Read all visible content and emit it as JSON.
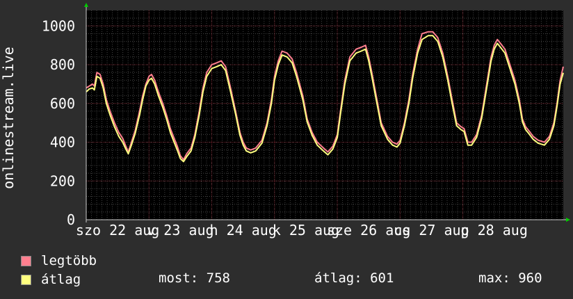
{
  "colors": {
    "background": "#2d2d2d",
    "plot_background": "#000000",
    "grid_major": "#6a1c26",
    "grid_minor": "#444444",
    "max_series": "#ff7f8f",
    "avg_series": "#ffff80",
    "axis_arrow": "#00cc00",
    "text": "#ffffff"
  },
  "chart_data": {
    "type": "line",
    "ylabel": "onlinestream.live",
    "ylim": [
      0,
      1080
    ],
    "yticks": [
      0,
      200,
      400,
      600,
      800,
      1000
    ],
    "xlim_days": [
      0,
      7.6
    ],
    "day_labels": [
      "szo 22 aug",
      "v 23 aug",
      "h 24 aug",
      "k 25 aug",
      "sze 26 aug",
      "cs 27 aug",
      "p 28 aug"
    ],
    "series": [
      {
        "name": "legtöbb",
        "key": "max",
        "x": [
          0,
          0.05,
          0.1,
          0.13,
          0.17,
          0.22,
          0.27,
          0.32,
          0.38,
          0.45,
          0.52,
          0.58,
          0.63,
          0.67,
          0.72,
          0.78,
          0.85,
          0.9,
          0.95,
          1.0,
          1.04,
          1.09,
          1.15,
          1.22,
          1.28,
          1.34,
          1.4,
          1.45,
          1.5,
          1.55,
          1.6,
          1.67,
          1.73,
          1.8,
          1.86,
          1.92,
          2.0,
          2.08,
          2.15,
          2.22,
          2.3,
          2.38,
          2.45,
          2.5,
          2.55,
          2.62,
          2.7,
          2.8,
          2.88,
          2.95,
          3.0,
          3.06,
          3.12,
          3.2,
          3.28,
          3.35,
          3.45,
          3.52,
          3.6,
          3.68,
          3.78,
          3.85,
          3.93,
          4.0,
          4.05,
          4.12,
          4.2,
          4.3,
          4.38,
          4.45,
          4.5,
          4.55,
          4.62,
          4.7,
          4.8,
          4.88,
          4.95,
          5.0,
          5.07,
          5.14,
          5.2,
          5.28,
          5.35,
          5.45,
          5.52,
          5.6,
          5.68,
          5.76,
          5.83,
          5.9,
          5.97,
          6.02,
          6.08,
          6.14,
          6.22,
          6.3,
          6.38,
          6.45,
          6.5,
          6.55,
          6.6,
          6.67,
          6.75,
          6.83,
          6.9,
          6.95,
          7.0,
          7.05,
          7.12,
          7.2,
          7.3,
          7.38,
          7.45,
          7.5,
          7.55,
          7.6
        ],
        "values": [
          680,
          690,
          700,
          690,
          760,
          750,
          700,
          620,
          560,
          500,
          450,
          420,
          380,
          350,
          400,
          460,
          560,
          640,
          700,
          740,
          750,
          720,
          660,
          600,
          540,
          470,
          420,
          380,
          330,
          310,
          340,
          370,
          440,
          560,
          680,
          760,
          800,
          810,
          820,
          790,
          680,
          560,
          450,
          400,
          370,
          360,
          370,
          410,
          500,
          620,
          740,
          820,
          870,
          860,
          830,
          760,
          640,
          520,
          450,
          400,
          370,
          350,
          380,
          440,
          560,
          720,
          840,
          880,
          890,
          900,
          840,
          760,
          640,
          500,
          430,
          400,
          390,
          410,
          500,
          620,
          750,
          880,
          960,
          970,
          970,
          940,
          860,
          740,
          620,
          500,
          480,
          470,
          400,
          400,
          440,
          540,
          700,
          840,
          900,
          930,
          910,
          880,
          800,
          720,
          620,
          520,
          480,
          460,
          430,
          410,
          400,
          430,
          500,
          600,
          720,
          790
        ]
      },
      {
        "name": "átlag",
        "key": "avg",
        "x": [
          0,
          0.05,
          0.1,
          0.13,
          0.17,
          0.22,
          0.27,
          0.32,
          0.38,
          0.45,
          0.52,
          0.58,
          0.63,
          0.67,
          0.72,
          0.78,
          0.85,
          0.9,
          0.95,
          1.0,
          1.04,
          1.09,
          1.15,
          1.22,
          1.28,
          1.34,
          1.4,
          1.45,
          1.5,
          1.55,
          1.6,
          1.67,
          1.73,
          1.8,
          1.86,
          1.92,
          2.0,
          2.08,
          2.15,
          2.22,
          2.3,
          2.38,
          2.45,
          2.5,
          2.55,
          2.62,
          2.7,
          2.8,
          2.88,
          2.95,
          3.0,
          3.06,
          3.12,
          3.2,
          3.28,
          3.35,
          3.45,
          3.52,
          3.6,
          3.68,
          3.78,
          3.85,
          3.93,
          4.0,
          4.05,
          4.12,
          4.2,
          4.3,
          4.38,
          4.45,
          4.5,
          4.55,
          4.62,
          4.7,
          4.8,
          4.88,
          4.95,
          5.0,
          5.07,
          5.14,
          5.2,
          5.28,
          5.35,
          5.45,
          5.52,
          5.6,
          5.68,
          5.76,
          5.83,
          5.9,
          5.97,
          6.02,
          6.08,
          6.14,
          6.22,
          6.3,
          6.38,
          6.45,
          6.5,
          6.55,
          6.6,
          6.67,
          6.75,
          6.83,
          6.9,
          6.95,
          7.0,
          7.05,
          7.12,
          7.2,
          7.3,
          7.38,
          7.45,
          7.5,
          7.55,
          7.6
        ],
        "values": [
          660,
          675,
          680,
          670,
          740,
          730,
          680,
          600,
          540,
          480,
          430,
          400,
          365,
          340,
          385,
          445,
          540,
          620,
          690,
          720,
          730,
          700,
          640,
          580,
          520,
          450,
          400,
          360,
          315,
          300,
          325,
          355,
          425,
          540,
          660,
          740,
          780,
          790,
          800,
          770,
          660,
          545,
          435,
          385,
          355,
          345,
          355,
          395,
          485,
          600,
          720,
          800,
          850,
          840,
          810,
          740,
          620,
          505,
          435,
          385,
          355,
          335,
          365,
          425,
          545,
          700,
          820,
          860,
          870,
          880,
          820,
          740,
          620,
          485,
          415,
          385,
          375,
          395,
          485,
          600,
          730,
          860,
          930,
          950,
          950,
          920,
          840,
          720,
          600,
          485,
          465,
          455,
          385,
          385,
          425,
          525,
          680,
          820,
          880,
          910,
          890,
          860,
          780,
          700,
          600,
          505,
          465,
          445,
          415,
          395,
          385,
          415,
          485,
          585,
          700,
          758
        ]
      }
    ],
    "legend": [
      {
        "key": "max",
        "label": "legtöbb"
      },
      {
        "key": "avg",
        "label": "átlag"
      }
    ],
    "stats": {
      "current": "most: 758",
      "average": "átlag: 601",
      "maximum": "max: 960"
    }
  }
}
